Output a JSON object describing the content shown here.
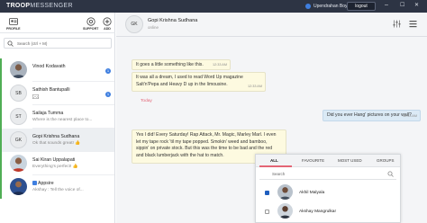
{
  "app": {
    "logo_main": "TROOP",
    "logo_thin": "MESSENGER"
  },
  "header": {
    "user_name": "Upendrahan Boyo",
    "logout_label": "logout",
    "min_glyph": "–",
    "max_glyph": "☐",
    "close_glyph": "✕"
  },
  "sidebar": {
    "profile_label": "PROFILE",
    "support_label": "SUPPORT",
    "add_label": "ADD",
    "search_placeholder": "Search (ctrl + M)",
    "contacts": [
      {
        "name": "Vinod Kodavath",
        "subtitle": "",
        "avatar": "photo",
        "badge": "1"
      },
      {
        "name": "Sathish Bantupalli",
        "subtitle": "",
        "initials": "SB",
        "avatar": "initials",
        "badge": "1"
      },
      {
        "name": "Sailaja Tumma",
        "subtitle": "Where is the nearest place to...",
        "initials": "ST",
        "avatar": "initials",
        "badge": ""
      },
      {
        "name": "Gopi Krishna Sudhana",
        "subtitle": "Ok that sounds great! 👍",
        "initials": "GK",
        "avatar": "initials",
        "badge": ""
      },
      {
        "name": "Sai Kiran Uppalapati",
        "subtitle": "Everything's perfect! 👍",
        "avatar": "photo",
        "badge": ""
      },
      {
        "name": "Appsire",
        "subtitle": "Akshay : Tell the voice of...",
        "avatar": "photo",
        "badge": ""
      }
    ]
  },
  "chat": {
    "contact_initials": "GK",
    "contact_name": "Gopi Krishna Sudhana",
    "contact_status": "online",
    "messages": [
      {
        "text": "It goes a little something like this.",
        "time": "12:33 AM"
      },
      {
        "text_1": "It was all a dream, I used to read Word Up magazine",
        "text_2": "Salt'n'Pepa and Heavy D up in the limousine.",
        "time": "12:33 AM"
      },
      {
        "text": "Did you ever Hang' pictures on your wall?",
        "time": "12:33 AM"
      },
      {
        "text_1": "Yes I did! Every Saturday! Rap Attack, Mr. Magic, Marley Marl. I even",
        "text_2": "let my tape rock 'til my tape popped. Smokin' weed and bamboo,",
        "text_3": "sippin' on private stock. But this was the time to be bad and the red",
        "text_4": "and black lumberjack with the hat to match.",
        "time": "12:33 AM"
      }
    ],
    "today_label": "Today"
  },
  "share": {
    "tabs": [
      "ALL",
      "FAVOURITE",
      "MOST USED",
      "GROUPS"
    ],
    "search_placeholder": "Search",
    "people": [
      {
        "name": "Akhil Malyala",
        "checked": true
      },
      {
        "name": "Akshay Mangrulkar",
        "checked": false
      }
    ]
  },
  "colors": {
    "header": "#2d3444",
    "accent_green": "#50ae55",
    "accent_pink": "#e36575",
    "badge_blue": "#3f7fe0"
  }
}
